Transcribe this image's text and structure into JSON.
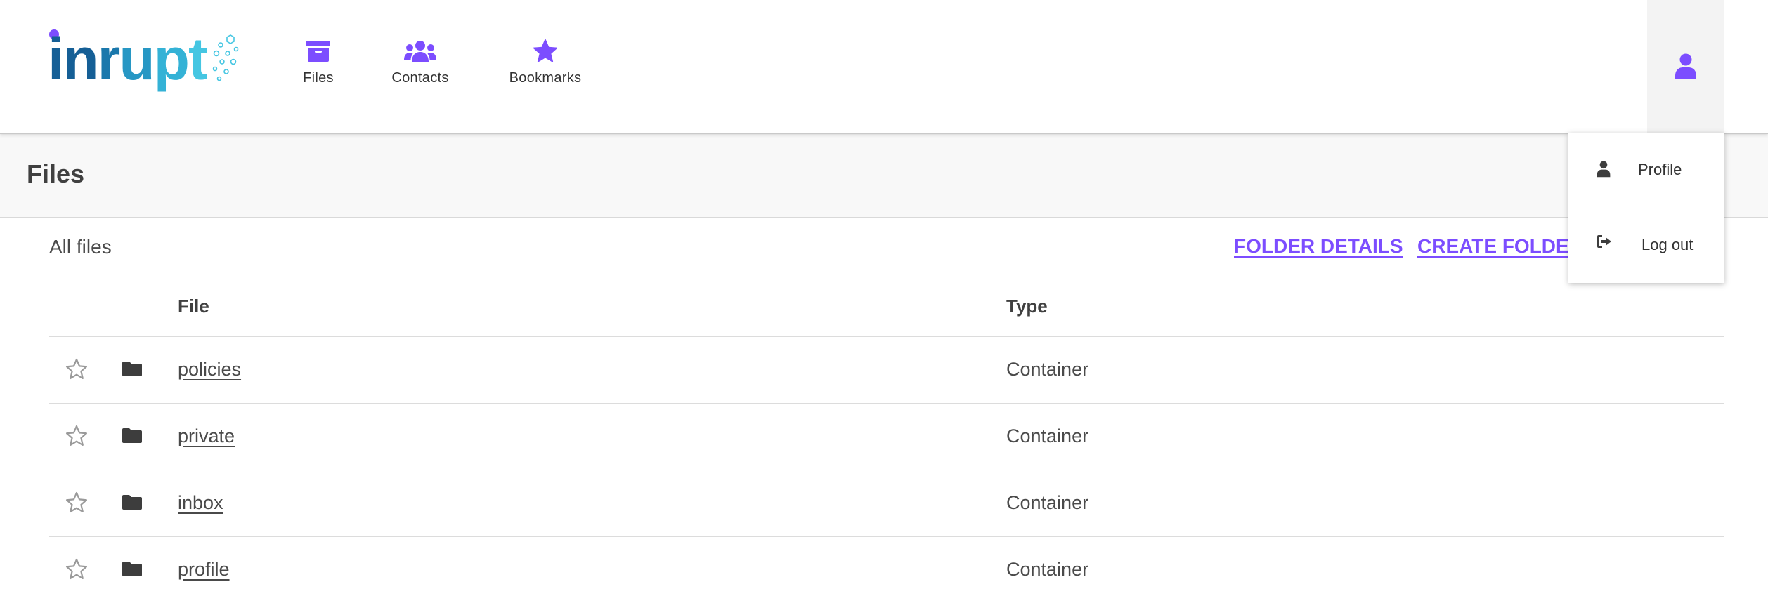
{
  "brand": {
    "logo_text": "inrupt"
  },
  "nav": {
    "items": [
      {
        "label": "Files",
        "icon": "archive-icon"
      },
      {
        "label": "Contacts",
        "icon": "users-icon"
      },
      {
        "label": "Bookmarks",
        "icon": "star-icon"
      }
    ]
  },
  "user_menu": {
    "icon": "user-icon",
    "items": [
      {
        "label": "Profile",
        "icon": "user-icon"
      },
      {
        "label": "Log out",
        "icon": "sign-out-icon"
      }
    ]
  },
  "page": {
    "title": "Files",
    "subtitle": "All files",
    "actions": {
      "folder_details": "FOLDER DETAILS",
      "create_folder": "CREATE FOLDER"
    }
  },
  "table": {
    "headers": {
      "file": "File",
      "type": "Type"
    },
    "rows": [
      {
        "name": "policies",
        "type": "Container"
      },
      {
        "name": "private",
        "type": "Container"
      },
      {
        "name": "inbox",
        "type": "Container"
      },
      {
        "name": "profile",
        "type": "Container"
      }
    ]
  },
  "colors": {
    "accent": "#7c4dff",
    "text": "#4a4a4a",
    "logo_blue": "#1a78ac",
    "logo_cyan": "#45c6e2"
  }
}
